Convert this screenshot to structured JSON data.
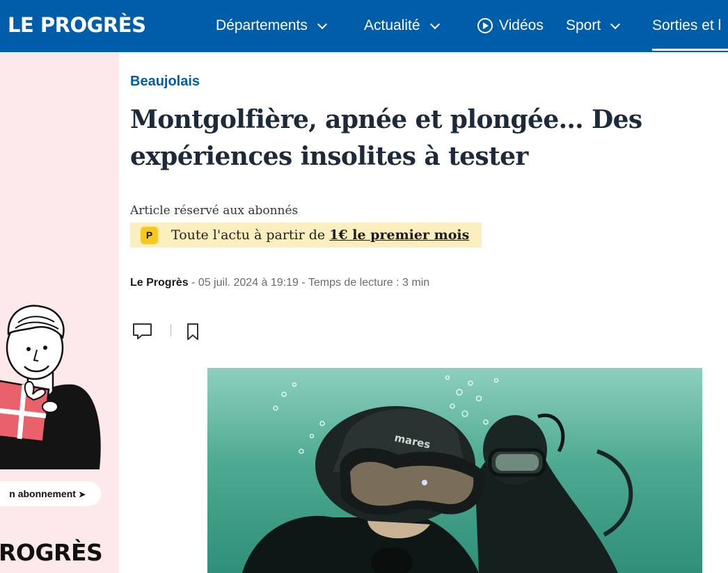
{
  "brand": {
    "logo_text": "LE PROGRÈS"
  },
  "nav": [
    {
      "label": "Départements",
      "has_dropdown": true
    },
    {
      "label": "Actualité",
      "has_dropdown": true
    },
    {
      "label": "Vidéos",
      "icon": "play-icon"
    },
    {
      "label": "Sport",
      "has_dropdown": true
    },
    {
      "label": "Sorties et l",
      "active": true
    }
  ],
  "promo": {
    "button_label": "n abonnement",
    "button_icon": "arrow-right-icon",
    "logo_text": "ROGRÈS"
  },
  "article": {
    "rubric": "Beaujolais",
    "title": "Montgolfière, apnée et plongée… Des expériences insolites à tester",
    "reserved_label": "Article réservé aux abonnés",
    "offer_badge": "P",
    "offer_text": "Toute l'actu à partir de ",
    "offer_link": "1€ le premier mois",
    "author": "Le Progrès",
    "meta": " - 05 juil. 2024 à 19:19 - Temps de lecture : 3 min"
  },
  "actions": {
    "comment_icon": "comment-icon",
    "bookmark_icon": "bookmark-icon"
  },
  "colors": {
    "brand_blue": "#005da9",
    "promo_pink": "#fde9ea",
    "offer_bg": "#fcefbf",
    "badge_yellow": "#f7c81f",
    "water": "#3f9f86"
  }
}
